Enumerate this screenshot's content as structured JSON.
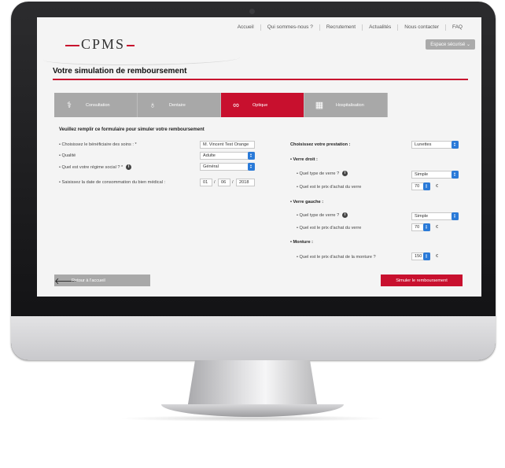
{
  "nav": [
    "Accueil",
    "Qui sommes-nous ?",
    "Recrutement",
    "Actualités",
    "Nous contacter",
    "FAQ"
  ],
  "logo": "CPMS",
  "secure_label": "Espace sécurisé",
  "page_title": "Votre simulation de remboursement",
  "tabs": [
    {
      "label": "Consultation",
      "icon": "stethoscope-icon",
      "active": false
    },
    {
      "label": "Dentaire",
      "icon": "tooth-icon",
      "active": false
    },
    {
      "label": "Optique",
      "icon": "glasses-icon",
      "active": true
    },
    {
      "label": "Hospitalisation",
      "icon": "hospital-icon",
      "active": false
    }
  ],
  "form_heading": "Veuillez remplir ce formulaire pour simuler votre remboursement",
  "left": {
    "beneficiary_label": "• Choisissez le bénéficiaire des soins : *",
    "beneficiary_value": "M. Vincent Test Orange",
    "quality_label": "• Qualité",
    "quality_value": "Adulte",
    "regime_label": "• Quel est votre régime social ? *",
    "regime_value": "Général",
    "date_label": "• Saisissez la date de consommation du bien médical :",
    "date_day": "01",
    "date_month": "06",
    "date_year": "2018"
  },
  "right": {
    "prestation_label": "Choisissez votre prestation :",
    "prestation_value": "Lunettes",
    "verre_droit": "• Verre droit :",
    "vd_type_label": "• Quel type de verre ?",
    "vd_type_value": "Simple",
    "vd_price_label": "• Quel est le prix d'achat du verre",
    "vd_price_value": "70",
    "verre_gauche": "• Verre gauche :",
    "vg_type_label": "• Quel type de verre ?",
    "vg_type_value": "Simple",
    "vg_price_label": "• Quel est le prix d'achat du verre",
    "vg_price_value": "70",
    "monture": "• Monture :",
    "monture_price_label": "• Quel est le prix d'achat de la monture ?",
    "monture_price_value": "150",
    "currency": "€"
  },
  "back_label": "Retour à l'accueil",
  "simulate_label": "Simuler le remboursement",
  "colors": {
    "accent": "#c8102e",
    "tab_inactive": "#a8a8a8",
    "select_arrow": "#2a7ad8"
  }
}
